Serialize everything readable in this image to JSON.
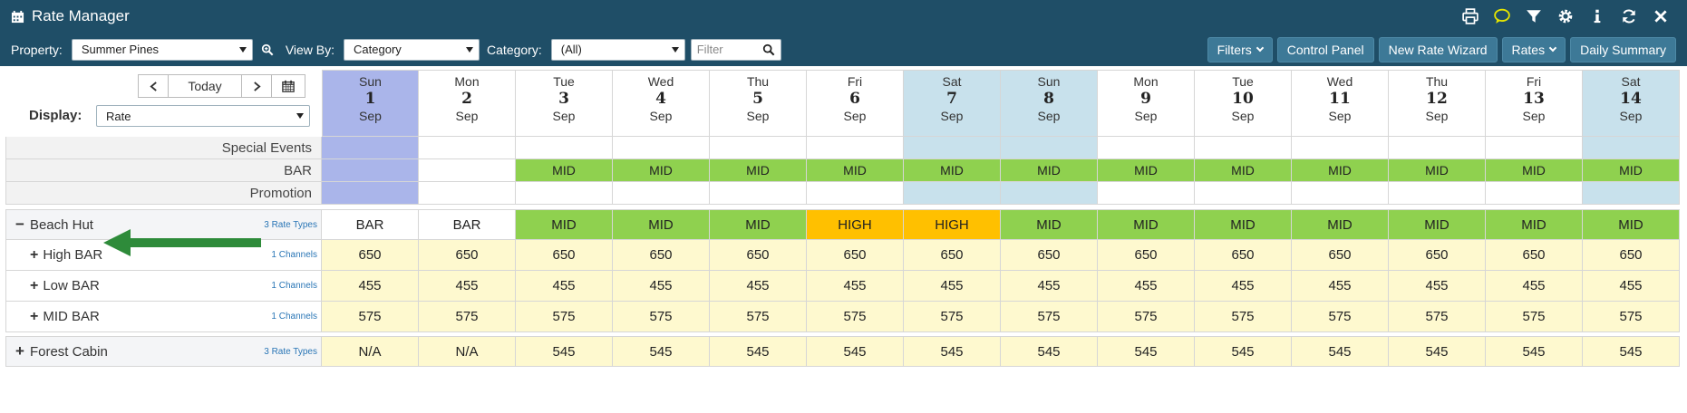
{
  "app": {
    "title": "Rate Manager"
  },
  "header_tools": [
    {
      "name": "print-icon"
    },
    {
      "name": "comment-icon"
    },
    {
      "name": "funnel-icon"
    },
    {
      "name": "gear-icon"
    },
    {
      "name": "info-icon"
    },
    {
      "name": "refresh-icon"
    },
    {
      "name": "close-icon"
    }
  ],
  "toolbar": {
    "property_label": "Property:",
    "property_value": "Summer Pines",
    "view_by_label": "View By:",
    "view_by_value": "Category",
    "category_label": "Category:",
    "category_value": "(All)",
    "filter_placeholder": "Filter",
    "buttons": {
      "filters": "Filters",
      "control_panel": "Control Panel",
      "new_rate_wizard": "New Rate Wizard",
      "rates": "Rates",
      "daily_summary": "Daily Summary"
    }
  },
  "nav": {
    "today": "Today",
    "display_label": "Display:",
    "display_value": "Rate"
  },
  "days": [
    {
      "dow": "Sun",
      "num": "1",
      "mon": "Sep",
      "hl": "today"
    },
    {
      "dow": "Mon",
      "num": "2",
      "mon": "Sep",
      "hl": ""
    },
    {
      "dow": "Tue",
      "num": "3",
      "mon": "Sep",
      "hl": ""
    },
    {
      "dow": "Wed",
      "num": "4",
      "mon": "Sep",
      "hl": ""
    },
    {
      "dow": "Thu",
      "num": "5",
      "mon": "Sep",
      "hl": ""
    },
    {
      "dow": "Fri",
      "num": "6",
      "mon": "Sep",
      "hl": ""
    },
    {
      "dow": "Sat",
      "num": "7",
      "mon": "Sep",
      "hl": "weekend"
    },
    {
      "dow": "Sun",
      "num": "8",
      "mon": "Sep",
      "hl": "weekend"
    },
    {
      "dow": "Mon",
      "num": "9",
      "mon": "Sep",
      "hl": ""
    },
    {
      "dow": "Tue",
      "num": "10",
      "mon": "Sep",
      "hl": ""
    },
    {
      "dow": "Wed",
      "num": "11",
      "mon": "Sep",
      "hl": ""
    },
    {
      "dow": "Thu",
      "num": "12",
      "mon": "Sep",
      "hl": ""
    },
    {
      "dow": "Fri",
      "num": "13",
      "mon": "Sep",
      "hl": ""
    },
    {
      "dow": "Sat",
      "num": "14",
      "mon": "Sep",
      "hl": "weekend"
    }
  ],
  "colors": {
    "today": "#aab5ea",
    "weekend": "#c8e1ec",
    "mid": "#8fd14f",
    "high": "#ffc000",
    "rate": "#fef9cf",
    "white": "#ffffff"
  },
  "rows": [
    {
      "label": "Special Events",
      "values": [
        "",
        "",
        "",
        "",
        "",
        "",
        "",
        "",
        "",
        "",
        "",
        "",
        "",
        ""
      ],
      "bg": "calendar"
    },
    {
      "label": "BAR",
      "values": [
        "",
        "",
        "MID",
        "MID",
        "MID",
        "MID",
        "MID",
        "MID",
        "MID",
        "MID",
        "MID",
        "MID",
        "MID",
        "MID"
      ],
      "bg": "bar"
    },
    {
      "label": "Promotion",
      "values": [
        "",
        "",
        "",
        "",
        "",
        "",
        "",
        "",
        "",
        "",
        "",
        "",
        "",
        ""
      ],
      "bg": "calendar"
    }
  ],
  "groups": [
    {
      "name": "Beach Hut",
      "toggle": "−",
      "rate_types": "3 Rate Types",
      "values": [
        "BAR",
        "BAR",
        "MID",
        "MID",
        "MID",
        "HIGH",
        "HIGH",
        "MID",
        "MID",
        "MID",
        "MID",
        "MID",
        "MID",
        "MID"
      ],
      "sub": [
        {
          "name": "High BAR",
          "toggle": "+",
          "channels": "1 Channels",
          "values": [
            "650",
            "650",
            "650",
            "650",
            "650",
            "650",
            "650",
            "650",
            "650",
            "650",
            "650",
            "650",
            "650",
            "650"
          ]
        },
        {
          "name": "Low BAR",
          "toggle": "+",
          "channels": "1 Channels",
          "values": [
            "455",
            "455",
            "455",
            "455",
            "455",
            "455",
            "455",
            "455",
            "455",
            "455",
            "455",
            "455",
            "455",
            "455"
          ]
        },
        {
          "name": "MID BAR",
          "toggle": "+",
          "channels": "1 Channels",
          "values": [
            "575",
            "575",
            "575",
            "575",
            "575",
            "575",
            "575",
            "575",
            "575",
            "575",
            "575",
            "575",
            "575",
            "575"
          ]
        }
      ]
    },
    {
      "name": "Forest Cabin",
      "toggle": "+",
      "rate_types": "3 Rate Types",
      "values": [
        "N/A",
        "N/A",
        "545",
        "545",
        "545",
        "545",
        "545",
        "545",
        "545",
        "545",
        "545",
        "545",
        "545",
        "545"
      ],
      "sub": []
    }
  ]
}
